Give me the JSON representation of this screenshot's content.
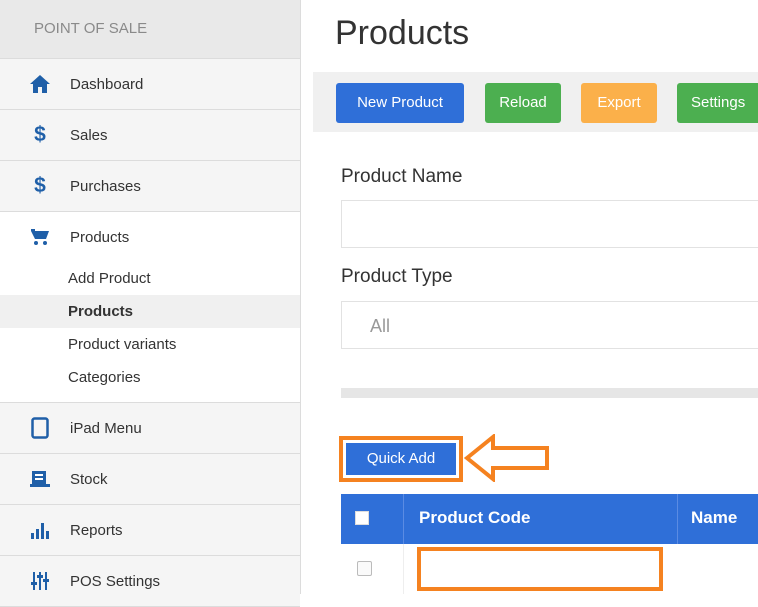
{
  "sidebar": {
    "header": "POINT OF SALE",
    "items": [
      {
        "label": "Dashboard",
        "icon": "home-icon"
      },
      {
        "label": "Sales",
        "icon": "dollar-icon"
      },
      {
        "label": "Purchases",
        "icon": "dollar-icon"
      },
      {
        "label": "Products",
        "icon": "cart-icon"
      },
      {
        "label": "iPad Menu",
        "icon": "tablet-icon"
      },
      {
        "label": "Stock",
        "icon": "stock-icon"
      },
      {
        "label": "Reports",
        "icon": "bar-chart-icon"
      },
      {
        "label": "POS Settings",
        "icon": "sliders-icon"
      }
    ],
    "products_sub": [
      {
        "label": "Add Product"
      },
      {
        "label": "Products"
      },
      {
        "label": "Product variants"
      },
      {
        "label": "Categories"
      }
    ]
  },
  "main": {
    "title": "Products",
    "toolbar": {
      "new_product": "New Product",
      "reload": "Reload",
      "export": "Export",
      "settings": "Settings"
    },
    "filters": {
      "product_name_label": "Product Name",
      "product_name_value": "",
      "product_type_label": "Product Type",
      "product_type_value": "All"
    },
    "quick_add": "Quick Add",
    "table": {
      "columns": [
        "Product Code",
        "Name"
      ]
    }
  },
  "colors": {
    "primary": "#2f6fd8",
    "success": "#4caf50",
    "warning": "#fbb04a",
    "highlight": "#f58220"
  }
}
